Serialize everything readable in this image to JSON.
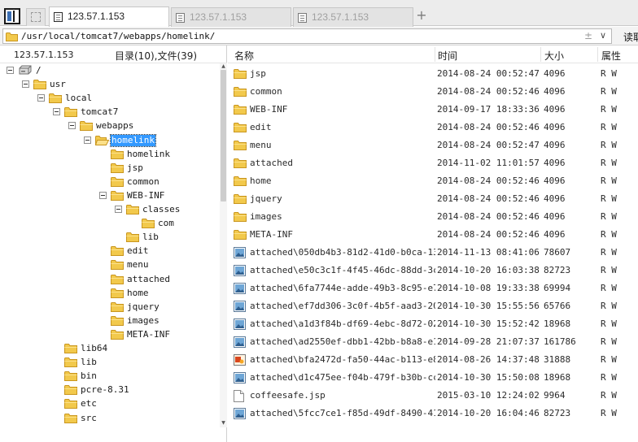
{
  "tabs": [
    {
      "label": "123.57.1.153",
      "active": true
    },
    {
      "label": "123.57.1.153",
      "active": false
    },
    {
      "label": "123.57.1.153",
      "active": false
    }
  ],
  "addressbar": {
    "path": "/usr/local/tomcat7/webapps/homelink/",
    "sort_glyph": "±",
    "dropdown_glyph": "∨",
    "read_label": "读取"
  },
  "left_pane": {
    "host": "123.57.1.153",
    "counts": "目录(10),文件(39)"
  },
  "tree": [
    {
      "label": "/",
      "level": 0,
      "expanded": true,
      "icon": "drive"
    },
    {
      "label": "usr",
      "level": 1,
      "expanded": true,
      "icon": "folder"
    },
    {
      "label": "local",
      "level": 2,
      "expanded": true,
      "icon": "folder"
    },
    {
      "label": "tomcat7",
      "level": 3,
      "expanded": true,
      "icon": "folder"
    },
    {
      "label": "webapps",
      "level": 4,
      "expanded": true,
      "icon": "folder"
    },
    {
      "label": "homelink",
      "level": 5,
      "expanded": true,
      "icon": "folder-open",
      "selected": true
    },
    {
      "label": "homelink",
      "level": 6,
      "icon": "folder"
    },
    {
      "label": "jsp",
      "level": 6,
      "icon": "folder"
    },
    {
      "label": "common",
      "level": 6,
      "icon": "folder"
    },
    {
      "label": "WEB-INF",
      "level": 6,
      "expanded": true,
      "icon": "folder"
    },
    {
      "label": "classes",
      "level": 7,
      "expanded": true,
      "icon": "folder"
    },
    {
      "label": "com",
      "level": 8,
      "icon": "folder"
    },
    {
      "label": "lib",
      "level": 7,
      "icon": "folder"
    },
    {
      "label": "edit",
      "level": 6,
      "icon": "folder"
    },
    {
      "label": "menu",
      "level": 6,
      "icon": "folder"
    },
    {
      "label": "attached",
      "level": 6,
      "icon": "folder"
    },
    {
      "label": "home",
      "level": 6,
      "icon": "folder"
    },
    {
      "label": "jquery",
      "level": 6,
      "icon": "folder"
    },
    {
      "label": "images",
      "level": 6,
      "icon": "folder"
    },
    {
      "label": "META-INF",
      "level": 6,
      "icon": "folder"
    },
    {
      "label": "lib64",
      "level": 3,
      "icon": "folder"
    },
    {
      "label": "lib",
      "level": 3,
      "icon": "folder"
    },
    {
      "label": "bin",
      "level": 3,
      "icon": "folder"
    },
    {
      "label": "pcre-8.31",
      "level": 3,
      "icon": "folder"
    },
    {
      "label": "etc",
      "level": 3,
      "icon": "folder"
    },
    {
      "label": "src",
      "level": 3,
      "icon": "folder"
    }
  ],
  "columns": {
    "name": "名称",
    "time": "时间",
    "size": "大小",
    "attr": "属性"
  },
  "files": [
    {
      "name": "jsp",
      "time": "2014-08-24 00:52:47",
      "size": "4096",
      "attr": "R W",
      "icon": "folder"
    },
    {
      "name": "common",
      "time": "2014-08-24 00:52:46",
      "size": "4096",
      "attr": "R W",
      "icon": "folder"
    },
    {
      "name": "WEB-INF",
      "time": "2014-09-17 18:33:36",
      "size": "4096",
      "attr": "R W",
      "icon": "folder"
    },
    {
      "name": "edit",
      "time": "2014-08-24 00:52:46",
      "size": "4096",
      "attr": "R W",
      "icon": "folder"
    },
    {
      "name": "menu",
      "time": "2014-08-24 00:52:47",
      "size": "4096",
      "attr": "R W",
      "icon": "folder"
    },
    {
      "name": "attached",
      "time": "2014-11-02 11:01:57",
      "size": "4096",
      "attr": "R W",
      "icon": "folder"
    },
    {
      "name": "home",
      "time": "2014-08-24 00:52:46",
      "size": "4096",
      "attr": "R W",
      "icon": "folder"
    },
    {
      "name": "jquery",
      "time": "2014-08-24 00:52:46",
      "size": "4096",
      "attr": "R W",
      "icon": "folder"
    },
    {
      "name": "images",
      "time": "2014-08-24 00:52:46",
      "size": "4096",
      "attr": "R W",
      "icon": "folder"
    },
    {
      "name": "META-INF",
      "time": "2014-08-24 00:52:46",
      "size": "4096",
      "attr": "R W",
      "icon": "folder"
    },
    {
      "name": "attached\\050db4b3-81d2-41d0-b0ca-13...",
      "time": "2014-11-13 08:41:06",
      "size": "78607",
      "attr": "R W",
      "icon": "image"
    },
    {
      "name": "attached\\e50c3c1f-4f45-46dc-88dd-3c...",
      "time": "2014-10-20 16:03:38",
      "size": "82723",
      "attr": "R W",
      "icon": "image"
    },
    {
      "name": "attached\\6fa7744e-adde-49b3-8c95-e7...",
      "time": "2014-10-08 19:33:38",
      "size": "69994",
      "attr": "R W",
      "icon": "image"
    },
    {
      "name": "attached\\ef7dd306-3c0f-4b5f-aad3-20...",
      "time": "2014-10-30 15:55:56",
      "size": "65766",
      "attr": "R W",
      "icon": "image"
    },
    {
      "name": "attached\\a1d3f84b-df69-4ebc-8d72-02...",
      "time": "2014-10-30 15:52:42",
      "size": "18968",
      "attr": "R W",
      "icon": "image"
    },
    {
      "name": "attached\\ad2550ef-dbb1-42bb-b8a8-e1...",
      "time": "2014-09-28 21:07:37",
      "size": "161786",
      "attr": "R W",
      "icon": "image"
    },
    {
      "name": "attached\\bfa2472d-fa50-44ac-b113-e8...",
      "time": "2014-08-26 14:37:48",
      "size": "31888",
      "attr": "R W",
      "icon": "image-color"
    },
    {
      "name": "attached\\d1c475ee-f04b-479f-b30b-cc...",
      "time": "2014-10-30 15:50:08",
      "size": "18968",
      "attr": "R W",
      "icon": "image"
    },
    {
      "name": "coffeesafe.jsp",
      "time": "2015-03-10 12:24:02",
      "size": "9964",
      "attr": "R W",
      "icon": "file"
    },
    {
      "name": "attached\\5fcc7ce1-f85d-49df-8490-41...",
      "time": "2014-10-20 16:04:46",
      "size": "82723",
      "attr": "R W",
      "icon": "image"
    }
  ],
  "colors": {
    "folder": "#f2c94c",
    "folder_edge": "#c9961f",
    "selection": "#3399ff"
  }
}
